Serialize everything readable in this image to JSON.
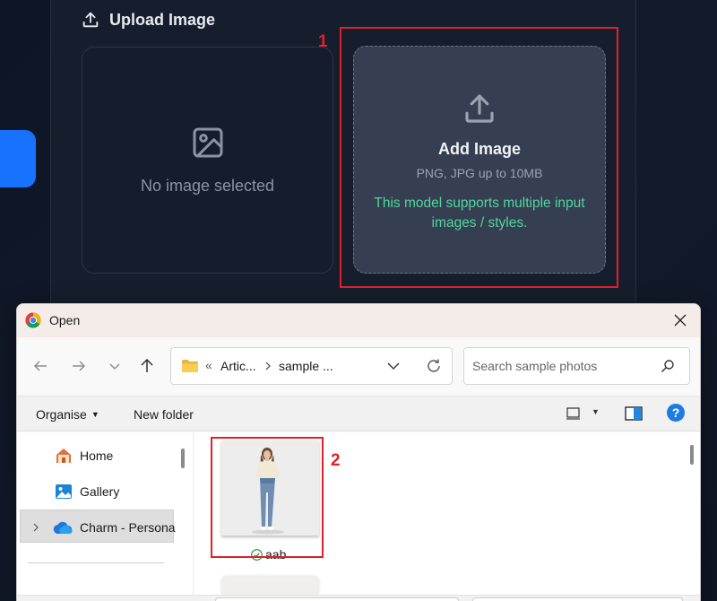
{
  "upload": {
    "heading": "Upload Image",
    "no_image_text": "No image selected",
    "add_title": "Add Image",
    "add_sub": "PNG, JPG up to 10MB",
    "add_note": "This model supports multiple input images / styles."
  },
  "annotations": [
    {
      "number": "1",
      "color": "#e0202a"
    },
    {
      "number": "2",
      "color": "#e0202a"
    }
  ],
  "dialog": {
    "title": "Open",
    "path_prefix": "«",
    "path_segments": [
      "Artic...",
      "sample ..."
    ],
    "search_placeholder": "Search sample photos",
    "toolbar": {
      "organise": "Organise",
      "new_folder": "New folder"
    },
    "sidebar": [
      {
        "label": "Home",
        "icon": "home-icon"
      },
      {
        "label": "Gallery",
        "icon": "gallery-icon"
      },
      {
        "label": "Charm - Persona",
        "icon": "onedrive-cloud-icon",
        "selected": true
      }
    ],
    "files": [
      {
        "name": "aab",
        "status": "synced-check-icon"
      }
    ]
  },
  "colors": {
    "accent_blue": "#1773ff",
    "note_green": "#4fd69c",
    "highlight_red": "#e0202a"
  }
}
